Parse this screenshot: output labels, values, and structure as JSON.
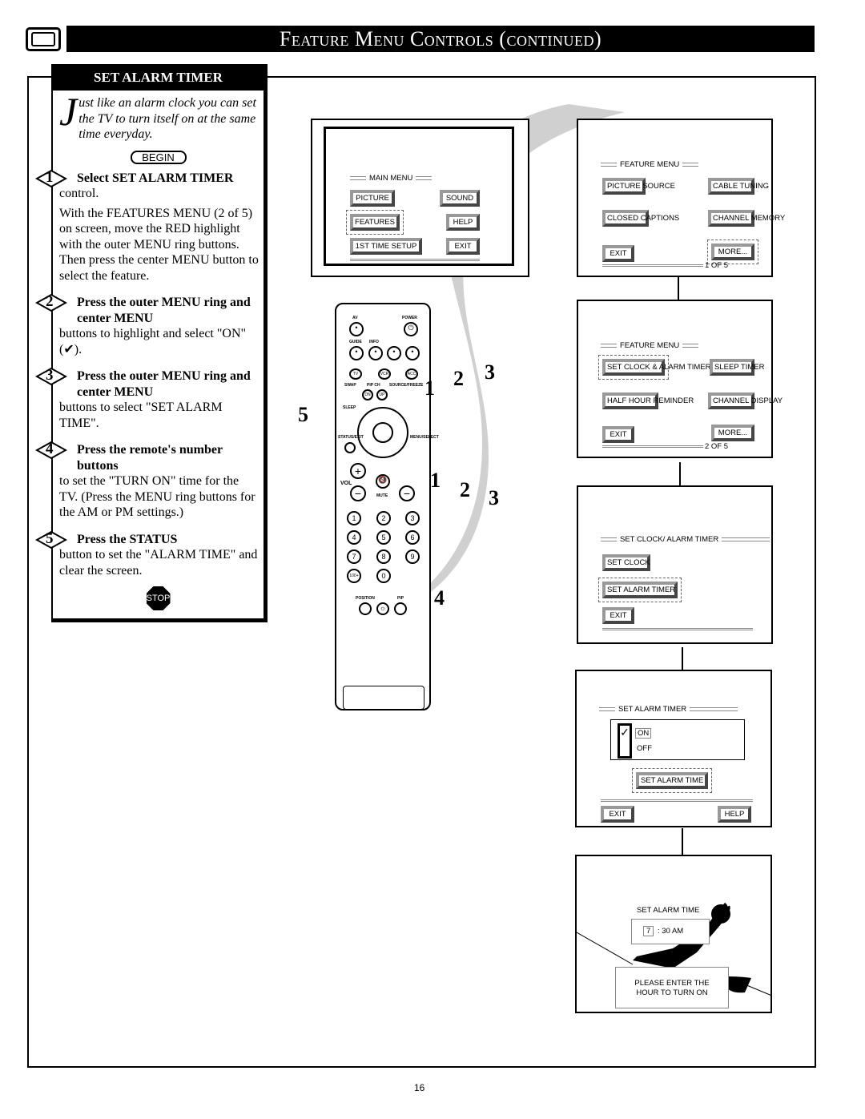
{
  "header": {
    "title": "Feature Menu Controls (continued)"
  },
  "left_panel": {
    "title": "SET ALARM TIMER",
    "intro_dropcap": "J",
    "intro": "ust like an alarm clock you can set the TV to turn itself on at the same time everyday.",
    "begin": "BEGIN",
    "steps": [
      {
        "num": "1",
        "heading": "Select SET ALARM TIMER",
        "text": "control.",
        "text2": "With the FEATURES MENU (2 of 5) on screen, move the RED highlight with the outer MENU ring buttons. Then press the center MENU button to select the feature."
      },
      {
        "num": "2",
        "heading": "Press the outer MENU ring and center MENU",
        "text": "buttons to highlight and select \"ON\" (✔)."
      },
      {
        "num": "3",
        "heading": "Press the outer MENU ring and center MENU",
        "text": "buttons to select \"SET ALARM TIME\"."
      },
      {
        "num": "4",
        "heading": "Press the remote's number buttons",
        "text": "to set the \"TURN ON\" time for the TV. (Press the MENU ring buttons for the AM or PM settings.)"
      },
      {
        "num": "5",
        "heading": "Press the STATUS",
        "text": "button to set the \"ALARM TIME\" and clear the screen."
      }
    ],
    "stop": "STOP"
  },
  "main_menu": {
    "title": "MAIN MENU",
    "buttons": [
      "PICTURE",
      "SOUND",
      "FEATURES",
      "HELP",
      "1ST TIME SETUP",
      "EXIT"
    ]
  },
  "remote": {
    "labels": {
      "av": "AV",
      "power": "POWER",
      "guide": "GUIDE",
      "info": "INFO",
      "tv": "TV",
      "vcr": "VCR",
      "acc": "ACC",
      "swap": "SWAP",
      "pipch": "PIP CH",
      "source": "SOURCE/FREEZE",
      "dn": "DN",
      "up": "UP",
      "sleep": "SLEEP",
      "status": "STATUS/EXIT",
      "menu": "MENU/SELECT",
      "vol": "VOL",
      "mute": "MUTE",
      "position": "POSITION",
      "pip": "PIP"
    },
    "digits": [
      "1",
      "2",
      "3",
      "4",
      "5",
      "6",
      "7",
      "8",
      "9",
      "100+",
      "0"
    ]
  },
  "callouts": {
    "a": [
      "1",
      "2",
      "3"
    ],
    "b": [
      "1",
      "2",
      "3"
    ],
    "c": "4",
    "d": "5"
  },
  "screen1": {
    "title": "FEATURE MENU",
    "buttons": [
      "PICTURE SOURCE",
      "CABLE TUNING",
      "CLOSED CAPTIONS",
      "CHANNEL MEMORY",
      "EXIT",
      "MORE..."
    ],
    "page": "1 OF 5"
  },
  "screen2": {
    "title": "FEATURE MENU",
    "buttons": [
      "SET CLOCK & ALARM TIMER",
      "SLEEP TIMER",
      "HALF HOUR REMINDER",
      "CHANNEL DISPLAY",
      "EXIT",
      "MORE..."
    ],
    "page": "2 OF 5"
  },
  "screen3": {
    "title": "SET CLOCK/ ALARM TIMER",
    "buttons": [
      "SET CLOCK",
      "SET ALARM TIMER",
      "EXIT"
    ]
  },
  "screen4": {
    "title": "SET ALARM TIMER",
    "check": "✓",
    "on": "ON",
    "off": "OFF",
    "set_time": "SET ALARM TIME",
    "exit": "EXIT",
    "help": "HELP"
  },
  "screen5": {
    "title": "SET ALARM TIME",
    "hour": "7",
    "rest": ": 30  AM",
    "prompt": "PLEASE ENTER THE HOUR TO TURN ON"
  },
  "page_number": "16"
}
